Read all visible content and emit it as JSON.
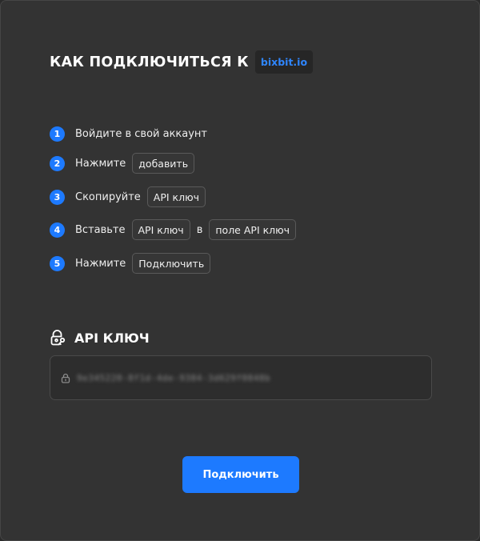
{
  "header": {
    "title": "КАК ПОДКЛЮЧИТЬСЯ К",
    "brand": "bixbit.io"
  },
  "steps": [
    {
      "num": "1",
      "text": "Войдите в свой аккаунт"
    },
    {
      "num": "2",
      "text": "Нажмите",
      "chip": "добавить"
    },
    {
      "num": "3",
      "text": "Скопируйте",
      "chip": "API ключ"
    },
    {
      "num": "4",
      "text": "Вставьте",
      "chip": "API ключ",
      "joiner": "в",
      "chip2": "поле API ключ"
    },
    {
      "num": "5",
      "text": "Нажмите",
      "chip": "Подключить"
    }
  ],
  "api_key": {
    "title": "API КЛЮЧ",
    "value": "9e345220-8f1d-4de-9384-3d629f0848b"
  },
  "actions": {
    "connect_label": "Подключить"
  },
  "colors": {
    "accent": "#1d7aff",
    "panel": "#333333",
    "background": "#2b2b2b"
  },
  "icons": {
    "api_header": "lock-key-icon",
    "field": "lock-icon"
  }
}
